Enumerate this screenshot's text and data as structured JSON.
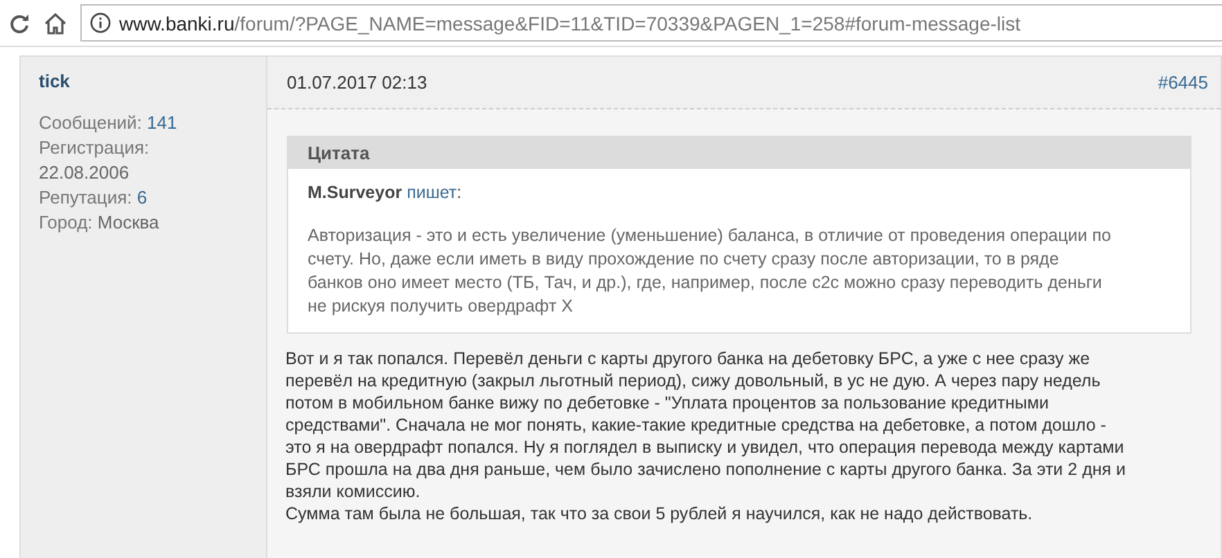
{
  "browser": {
    "url_host": "www.banki.ru",
    "url_rest": "/forum/?PAGE_NAME=message&FID=11&TID=70339&PAGEN_1=258#forum-message-list"
  },
  "author": {
    "name": "tick",
    "stats": [
      {
        "label": "Сообщений:",
        "value": "141",
        "link": true
      },
      {
        "label": "Регистрация:",
        "value": "22.08.2006",
        "link": false,
        "wrap": true
      },
      {
        "label": "Репутация:",
        "value": "6",
        "link": true
      },
      {
        "label": "Город:",
        "value": "Москва",
        "link": false
      }
    ]
  },
  "post": {
    "date": "01.07.2017 02:13",
    "number": "#6445",
    "quote": {
      "title": "Цитата",
      "author": "M.Surveyor",
      "writes": "пишет",
      "colon": ":",
      "lines": [
        "Авторизация - это и есть увеличение (уменьшение) баланса, в отличие от проведения операции по",
        "счету. Но, даже если иметь в виду прохождение по счету сразу после авторизации, то в ряде",
        "банков оно имеет место (ТБ, Тач, и др.), где, например, после c2c можно сразу переводить деньги",
        "не рискуя получить овердрафт Х"
      ]
    },
    "paragraphs": [
      [
        "Вот и я так попался. Перевёл деньги с карты другого банка на дебетовку БРС, а уже с нее сразу же",
        "перевёл на кредитную (закрыл льготный период), сижу довольный, в ус не дую. А через пару недель",
        "потом в мобильном банке вижу по дебетовке - \"Уплата процентов за пользование кредитными",
        "средствами\". Сначала не мог понять, какие-такие кредитные средства на дебетовке, а потом дошло -",
        "это я на овердрафт попался. Ну я поглядел в выписку и увидел, что операция перевода между картами",
        "БРС прошла на два дня раньше, чем было зачислено пополнение с карты другого банка. За эти 2 дня и",
        "взяли комиссию."
      ],
      [
        "Сумма там была не большая, так что за свои 5 рублей я научился, как не надо действовать."
      ]
    ]
  }
}
